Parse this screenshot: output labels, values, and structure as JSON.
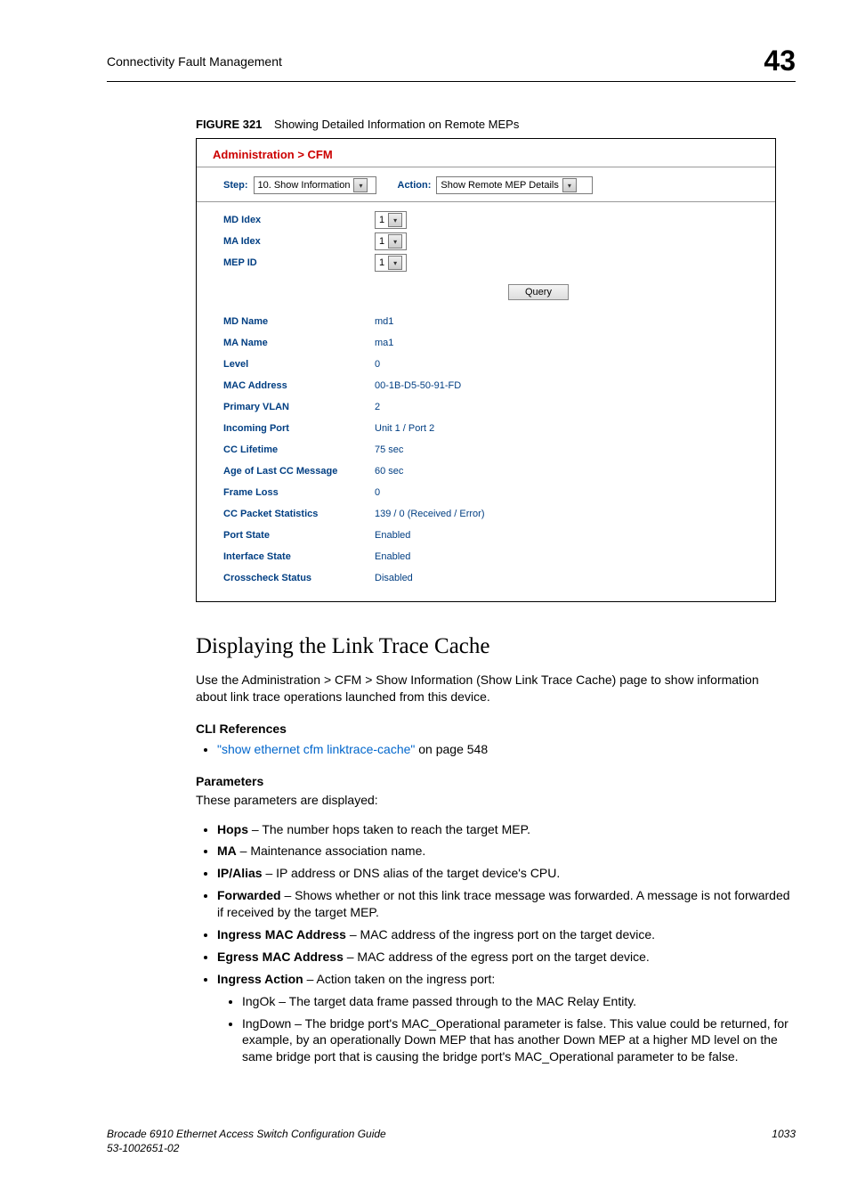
{
  "header": {
    "section": "Connectivity Fault Management",
    "chapter": "43"
  },
  "figure": {
    "label": "FIGURE 321",
    "caption": "Showing Detailed Information on Remote MEPs"
  },
  "ui": {
    "breadcrumb": "Administration > CFM",
    "step_label": "Step:",
    "step_value": "10. Show Information",
    "action_label": "Action:",
    "action_value": "Show Remote MEP Details",
    "query_button": "Query",
    "inputs": [
      {
        "label": "MD Idex",
        "value": "1"
      },
      {
        "label": "MA Idex",
        "value": "1"
      },
      {
        "label": "MEP ID",
        "value": "1"
      }
    ],
    "results": [
      {
        "label": "MD Name",
        "value": "md1"
      },
      {
        "label": "MA Name",
        "value": "ma1"
      },
      {
        "label": "Level",
        "value": "0"
      },
      {
        "label": "MAC Address",
        "value": "00-1B-D5-50-91-FD"
      },
      {
        "label": "Primary VLAN",
        "value": "2"
      },
      {
        "label": "Incoming Port",
        "value": "Unit 1 / Port 2"
      },
      {
        "label": "CC Lifetime",
        "value": "75 sec"
      },
      {
        "label": "Age of Last CC Message",
        "value": "60 sec"
      },
      {
        "label": "Frame Loss",
        "value": "0"
      },
      {
        "label": "CC Packet Statistics",
        "value": "139 / 0 (Received / Error)"
      },
      {
        "label": "Port State",
        "value": "Enabled"
      },
      {
        "label": "Interface State",
        "value": "Enabled"
      },
      {
        "label": "Crosscheck Status",
        "value": "Disabled"
      }
    ]
  },
  "section_title": "Displaying the Link Trace Cache",
  "intro": "Use the Administration > CFM > Show Information (Show Link Trace Cache) page to show information about link trace operations launched from this device.",
  "cli_heading": "CLI References",
  "cli_link": "\"show ethernet cfm linktrace-cache\"",
  "cli_suffix": " on page 548",
  "params_heading": "Parameters",
  "params_intro": "These parameters are displayed:",
  "params": [
    {
      "term": "Hops",
      "desc": " – The number hops taken to reach the target MEP."
    },
    {
      "term": "MA",
      "desc": " – Maintenance association name."
    },
    {
      "term": "IP/Alias",
      "desc": " – IP address or DNS alias of the target device's CPU."
    },
    {
      "term": "Forwarded",
      "desc": " – Shows whether or not this link trace message was forwarded. A message is not forwarded if received by the target MEP."
    },
    {
      "term": "Ingress MAC Address",
      "desc": " – MAC address of the ingress port on the target device."
    },
    {
      "term": "Egress MAC Address",
      "desc": " – MAC address of the egress port on the target device."
    },
    {
      "term": "Ingress Action",
      "desc": " – Action taken on the ingress port:"
    }
  ],
  "ingress_sub": [
    {
      "term": "IngOk",
      "desc": " – The target data frame passed through to the MAC Relay Entity."
    },
    {
      "term": "IngDown",
      "desc": " – The bridge port's MAC_Operational parameter is false. This value could be returned, for example, by an operationally Down MEP that has another Down MEP at a higher MD level on the same bridge port that is causing the bridge port's MAC_Operational parameter to be false."
    }
  ],
  "footer": {
    "line1": "Brocade 6910 Ethernet Access Switch Configuration Guide",
    "line2": "53-1002651-02",
    "page": "1033"
  }
}
